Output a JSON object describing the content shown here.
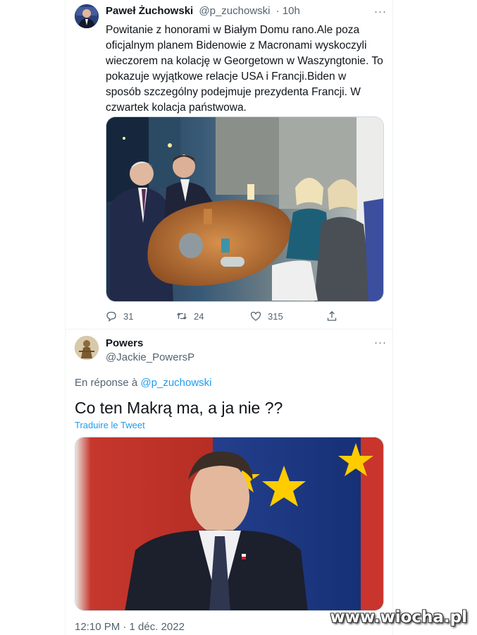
{
  "tweet1": {
    "author_name": "Paweł Żuchowski",
    "author_handle": "@p_zuchowski",
    "time": "10h",
    "text": "Powitanie z honorami w Białym Domu rano.Ale poza oficjalnym planem Bidenowie z Macronami wyskoczyli wieczorem na kolację w Georgetown w Waszyngtonie. To pokazuje wyjątkowe relacje USA i Francji.Biden w sposób szczególny podejmuje prezydenta Francji. W czwartek kolacja państwowa.",
    "replies": "31",
    "retweets": "24",
    "likes": "315",
    "more_icon": "more-horizontal-icon"
  },
  "tweet2": {
    "author_name": "Powers",
    "author_handle": "@Jackie_PowersP",
    "reply_prefix": "En réponse à",
    "reply_to": "@p_zuchowski",
    "text": "Co ten Makrą ma, a ja nie ??",
    "translate_label": "Traduire le Tweet",
    "timestamp": "12:10 PM · 1 déc. 2022",
    "more_icon": "more-horizontal-icon"
  },
  "watermark": "www.wiocha.pl",
  "colors": {
    "link": "#1d9bf0",
    "secondary_text": "#536471",
    "primary_text": "#0f1419",
    "divider": "#eff3f4"
  }
}
